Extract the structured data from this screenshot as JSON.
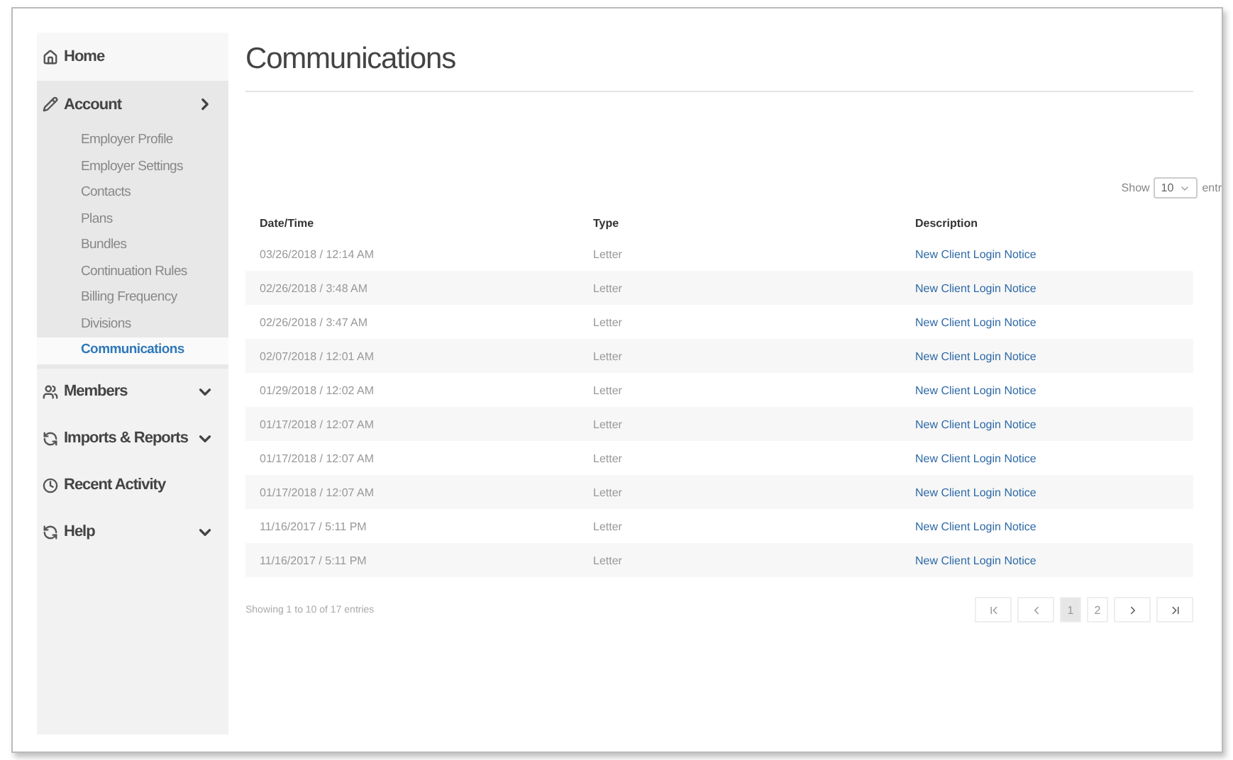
{
  "sidebar": {
    "items": [
      {
        "label": "Home",
        "kind": "link"
      },
      {
        "label": "Account",
        "kind": "menu",
        "expanded": true,
        "children": [
          {
            "label": "Employer Profile",
            "selected": false
          },
          {
            "label": "Employer Settings",
            "selected": false
          },
          {
            "label": "Contacts",
            "selected": false
          },
          {
            "label": "Plans",
            "selected": false
          },
          {
            "label": "Bundles",
            "selected": false
          },
          {
            "label": "Continuation Rules",
            "selected": false
          },
          {
            "label": "Billing Frequency",
            "selected": false
          },
          {
            "label": "Divisions",
            "selected": false
          },
          {
            "label": "Communications",
            "selected": true
          }
        ]
      },
      {
        "label": "Members",
        "kind": "menu",
        "expanded": false
      },
      {
        "label": "Imports & Reports",
        "kind": "menu",
        "expanded": false
      },
      {
        "label": "Recent Activity",
        "kind": "link"
      },
      {
        "label": "Help",
        "kind": "menu",
        "expanded": false
      }
    ]
  },
  "page": {
    "title": "Communications"
  },
  "length_control": {
    "before": "Show",
    "value": "10",
    "after": "entr"
  },
  "table": {
    "columns": [
      "Date/Time",
      "Type",
      "Description"
    ],
    "rows": [
      [
        "03/26/2018 / 12:14 AM",
        "Letter",
        "New Client Login Notice"
      ],
      [
        "02/26/2018 / 3:48 AM",
        "Letter",
        "New Client Login Notice"
      ],
      [
        "02/26/2018 / 3:47 AM",
        "Letter",
        "New Client Login Notice"
      ],
      [
        "02/07/2018 / 12:01 AM",
        "Letter",
        "New Client Login Notice"
      ],
      [
        "01/29/2018 / 12:02 AM",
        "Letter",
        "New Client Login Notice"
      ],
      [
        "01/17/2018 / 12:07 AM",
        "Letter",
        "New Client Login Notice"
      ],
      [
        "01/17/2018 / 12:07 AM",
        "Letter",
        "New Client Login Notice"
      ],
      [
        "01/17/2018 / 12:07 AM",
        "Letter",
        "New Client Login Notice"
      ],
      [
        "11/16/2017 / 5:11 PM",
        "Letter",
        "New Client Login Notice"
      ],
      [
        "11/16/2017 / 5:11 PM",
        "Letter",
        "New Client Login Notice"
      ]
    ]
  },
  "footer": {
    "info": "Showing 1 to 10 of 17 entries",
    "pages": [
      {
        "label": "1",
        "selected": true
      },
      {
        "label": "2",
        "selected": false
      }
    ]
  }
}
